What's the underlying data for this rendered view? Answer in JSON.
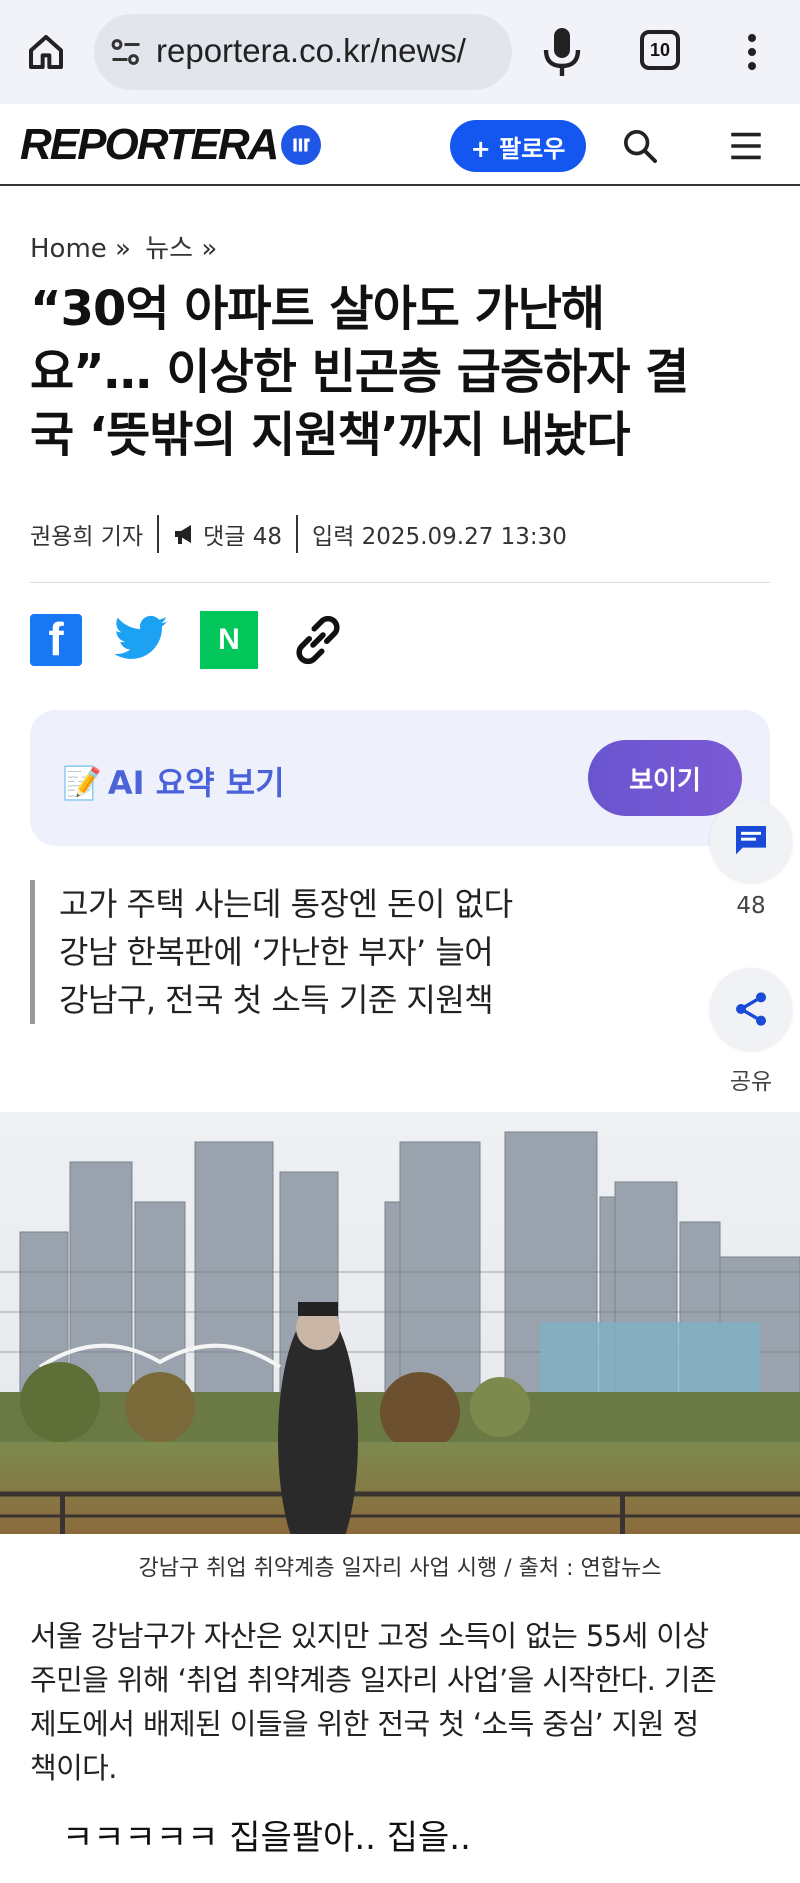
{
  "browser": {
    "url": "reportera.co.kr/news/",
    "tab_count": "10"
  },
  "site": {
    "logo_text": "REPORTERA",
    "follow_label": "+ 팔로우"
  },
  "article": {
    "breadcrumb": [
      "Home »",
      "뉴스 »"
    ],
    "headline_lines": [
      "“30억 아파트 살아도 가난해",
      "요”… 이상한 빈곤층 급증하자 결",
      "국 ‘뜻밖의 지원책’까지 내놨다"
    ],
    "author": "권용희 기자",
    "comments": "댓글 48",
    "published": "입력 2025.09.27 13:30",
    "ai_summary_label": "AI 요약 보기",
    "ai_summary_button": "보이기",
    "summary_lines": [
      "고가 주택 사는데 통장엔 돈이 없다",
      "강남 한복판에 ‘가난한 부자’ 늘어",
      "강남구, 전국 첫 소득 기준 지원책"
    ],
    "photo_caption": "강남구 취업 취약계층 일자리 사업 시행 / 출처 : 연합뉴스",
    "body_lines": [
      "서울 강남구가 자산은 있지만 고정 소득이 없는 55세 이상",
      "주민을 위해 ‘취업 취약계층 일자리 사업’을 시작한다. 기존",
      "제도에서 배제된 이들을 위한 전국 첫 ‘소득 중심’ 지원 정",
      "책이다."
    ]
  },
  "floating": {
    "comment_count": "48",
    "share_label": "공유"
  },
  "overlay": {
    "comment_text": "ㅋㅋㅋㅋㅋ 집을팔아.. 집을.."
  },
  "colors": {
    "brand_blue": "#1456f0",
    "ai_purple": "#6a55cf",
    "ai_text": "#4b63d9",
    "facebook": "#1877f2",
    "twitter": "#1da1f2",
    "naver": "#03c75a",
    "floating_icon": "#1a4bd8"
  }
}
